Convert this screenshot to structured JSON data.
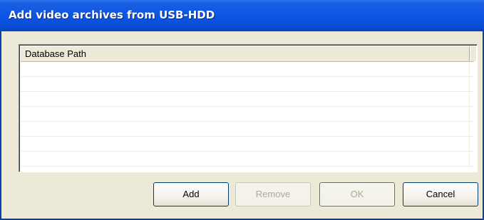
{
  "window": {
    "title": "Add video archives from USB-HDD"
  },
  "list": {
    "columns": [
      "Database Path"
    ],
    "rows": []
  },
  "buttons": {
    "add": "Add",
    "remove": "Remove",
    "ok": "OK",
    "cancel": "Cancel"
  },
  "colors": {
    "titlebar": "#0b55e6",
    "window_bg": "#ece9d8",
    "button_border": "#003c74",
    "disabled_text": "#aca899"
  }
}
